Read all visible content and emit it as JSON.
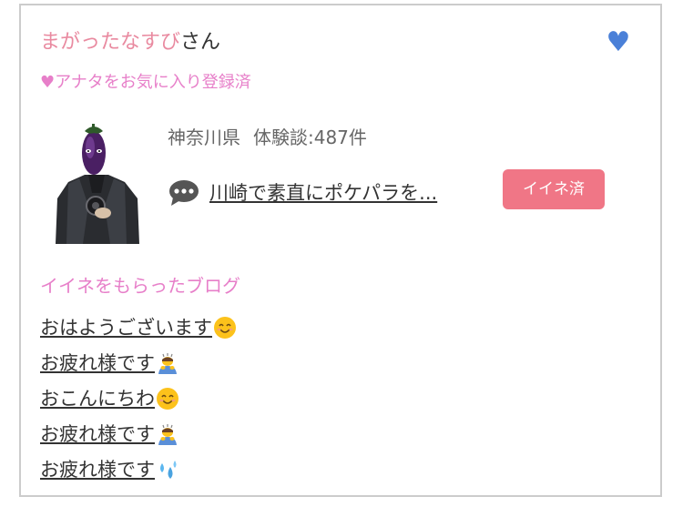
{
  "user": {
    "name": "まがったなすび",
    "suffix": "さん"
  },
  "favorite": {
    "status_text": "♥アナタをお気に入り登録済",
    "heart_icon": "heart-icon",
    "heart_color": "#4a80d8"
  },
  "profile": {
    "location": "神奈川県",
    "reviews_label": "体験談:487件"
  },
  "review": {
    "title": "川崎で素直にポケパラを...",
    "badge_label": "イイネ済",
    "badge_color": "#f07686"
  },
  "blogs": {
    "heading": "イイネをもらったブログ",
    "items": [
      {
        "title": "おはようございます",
        "emoji": "smiling-face-icon"
      },
      {
        "title": "お疲れ様です",
        "emoji": "bowing-person-icon"
      },
      {
        "title": "おこんにちわ",
        "emoji": "smiling-face-icon"
      },
      {
        "title": "お疲れ様です",
        "emoji": "bowing-person-icon"
      },
      {
        "title": "お疲れ様です",
        "emoji": "sweat-droplets-icon"
      }
    ]
  },
  "colors": {
    "pink_text": "#e77fc9",
    "name_pink": "#e98aa0",
    "border": "#cccccc"
  }
}
